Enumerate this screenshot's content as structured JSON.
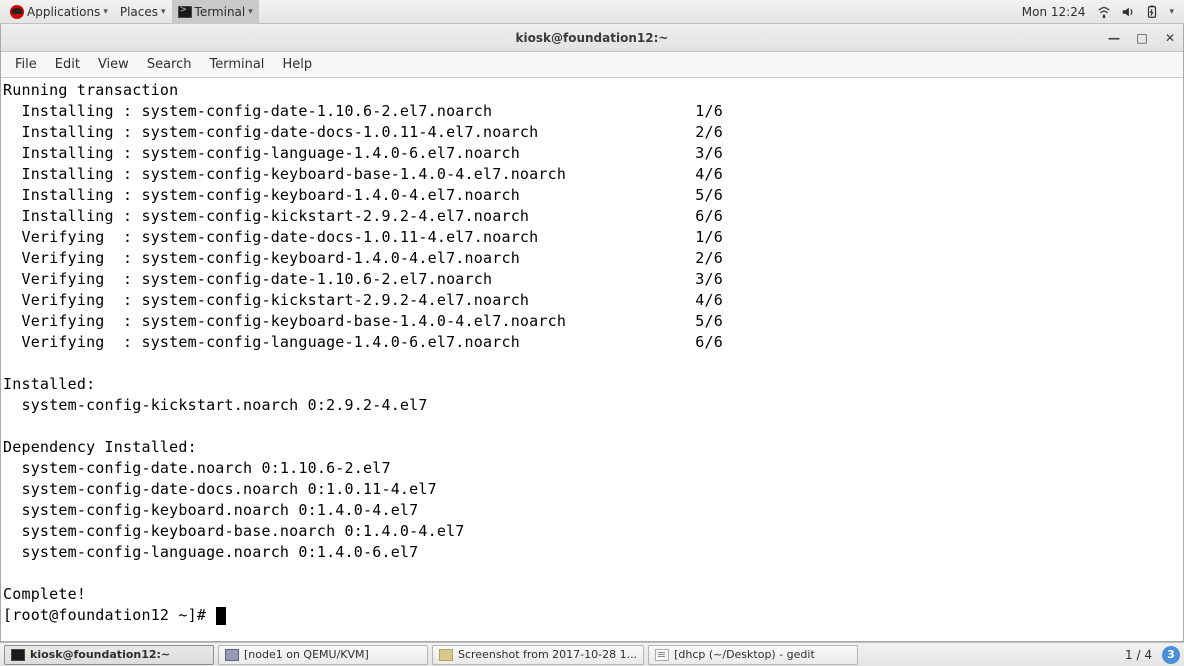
{
  "top_panel": {
    "applications_label": "Applications",
    "places_label": "Places",
    "terminal_label": "Terminal",
    "clock": "Mon 12:24"
  },
  "window": {
    "title": "kiosk@foundation12:~",
    "menus": [
      "File",
      "Edit",
      "View",
      "Search",
      "Terminal",
      "Help"
    ]
  },
  "terminal_lines": [
    "Running transaction",
    "  Installing : system-config-date-1.10.6-2.el7.noarch                      1/6",
    "  Installing : system-config-date-docs-1.0.11-4.el7.noarch                 2/6",
    "  Installing : system-config-language-1.4.0-6.el7.noarch                   3/6",
    "  Installing : system-config-keyboard-base-1.4.0-4.el7.noarch              4/6",
    "  Installing : system-config-keyboard-1.4.0-4.el7.noarch                   5/6",
    "  Installing : system-config-kickstart-2.9.2-4.el7.noarch                  6/6",
    "  Verifying  : system-config-date-docs-1.0.11-4.el7.noarch                 1/6",
    "  Verifying  : system-config-keyboard-1.4.0-4.el7.noarch                   2/6",
    "  Verifying  : system-config-date-1.10.6-2.el7.noarch                      3/6",
    "  Verifying  : system-config-kickstart-2.9.2-4.el7.noarch                  4/6",
    "  Verifying  : system-config-keyboard-base-1.4.0-4.el7.noarch              5/6",
    "  Verifying  : system-config-language-1.4.0-6.el7.noarch                   6/6",
    "",
    "Installed:",
    "  system-config-kickstart.noarch 0:2.9.2-4.el7",
    "",
    "Dependency Installed:",
    "  system-config-date.noarch 0:1.10.6-2.el7",
    "  system-config-date-docs.noarch 0:1.0.11-4.el7",
    "  system-config-keyboard.noarch 0:1.4.0-4.el7",
    "  system-config-keyboard-base.noarch 0:1.4.0-4.el7",
    "  system-config-language.noarch 0:1.4.0-6.el7",
    "",
    "Complete!"
  ],
  "prompt": "[root@foundation12 ~]# ",
  "taskbar": {
    "items": [
      {
        "label": "kiosk@foundation12:~",
        "active": true
      },
      {
        "label": "[node1 on QEMU/KVM]",
        "active": false
      },
      {
        "label": "Screenshot from 2017-10-28 1...",
        "active": false
      },
      {
        "label": "[dhcp (~/Desktop) - gedit",
        "active": false
      }
    ],
    "workspace": "1 / 4",
    "notif_count": "3"
  }
}
